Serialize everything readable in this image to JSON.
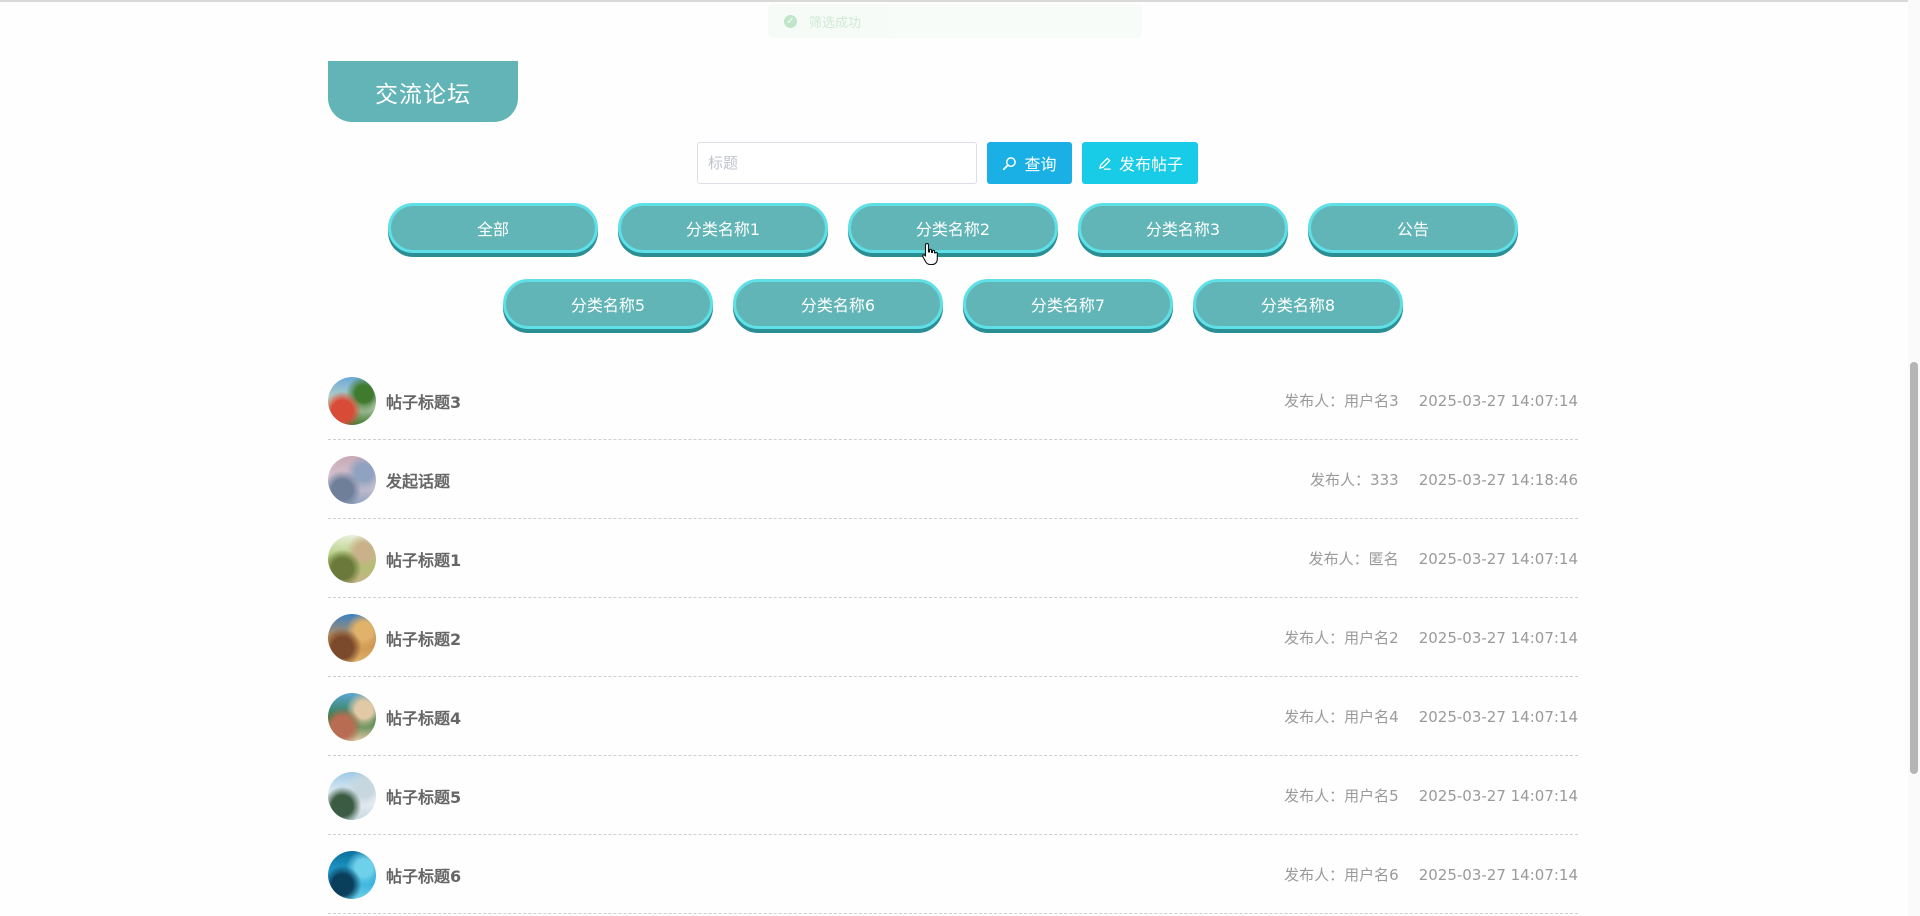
{
  "toast": {
    "icon": "check-circle-icon",
    "text": "筛选成功"
  },
  "page": {
    "title": "交流论坛"
  },
  "search": {
    "placeholder": "标题",
    "value": "",
    "search_button": "查询",
    "search_icon": "search-icon",
    "post_button": "发布帖子",
    "post_icon": "edit-icon"
  },
  "categories": {
    "row1": [
      "全部",
      "分类名称1",
      "分类名称2",
      "分类名称3",
      "公告"
    ],
    "row2": [
      "分类名称5",
      "分类名称6",
      "分类名称7",
      "分类名称8"
    ]
  },
  "posts": [
    {
      "title": "帖子标题3",
      "author": "发布人：用户名3",
      "time": "2025-03-27 14:07:14",
      "avatar": "landscape-flowers-avatar",
      "colors": [
        "#6aa9d9",
        "#c7d8c3",
        "#d84b36",
        "#3f7a2f"
      ]
    },
    {
      "title": "发起话题",
      "author": "发布人：333",
      "time": "2025-03-27 14:18:46",
      "avatar": "lake-avatar",
      "colors": [
        "#c9a9b5",
        "#d7c8d6",
        "#6f7f9a",
        "#8fa2bf"
      ]
    },
    {
      "title": "帖子标题1",
      "author": "发布人：匿名",
      "time": "2025-03-27 14:07:14",
      "avatar": "girl-field-avatar",
      "colors": [
        "#e9f0d8",
        "#a8c46c",
        "#6b7a3b",
        "#c9b28a"
      ]
    },
    {
      "title": "帖子标题2",
      "author": "发布人：用户名2",
      "time": "2025-03-27 14:07:14",
      "avatar": "castle-avatar",
      "colors": [
        "#3b82c4",
        "#c98c4a",
        "#7b4a2c",
        "#e1b36a"
      ]
    },
    {
      "title": "帖子标题4",
      "author": "发布人：用户名4",
      "time": "2025-03-27 14:07:14",
      "avatar": "house-garden-avatar",
      "colors": [
        "#5aa5d6",
        "#2f7a3a",
        "#b86d53",
        "#e2c9a6"
      ]
    },
    {
      "title": "帖子标题5",
      "author": "发布人：用户名5",
      "time": "2025-03-27 14:07:14",
      "avatar": "snow-forest-avatar",
      "colors": [
        "#9ec9e5",
        "#eef3f7",
        "#3b5b43",
        "#c7d7df"
      ]
    },
    {
      "title": "帖子标题6",
      "author": "发布人：用户名6",
      "time": "2025-03-27 14:07:14",
      "avatar": "underwater-avatar",
      "colors": [
        "#0b6f9c",
        "#27a7d6",
        "#0a3f5c",
        "#6fd0ea"
      ]
    }
  ]
}
